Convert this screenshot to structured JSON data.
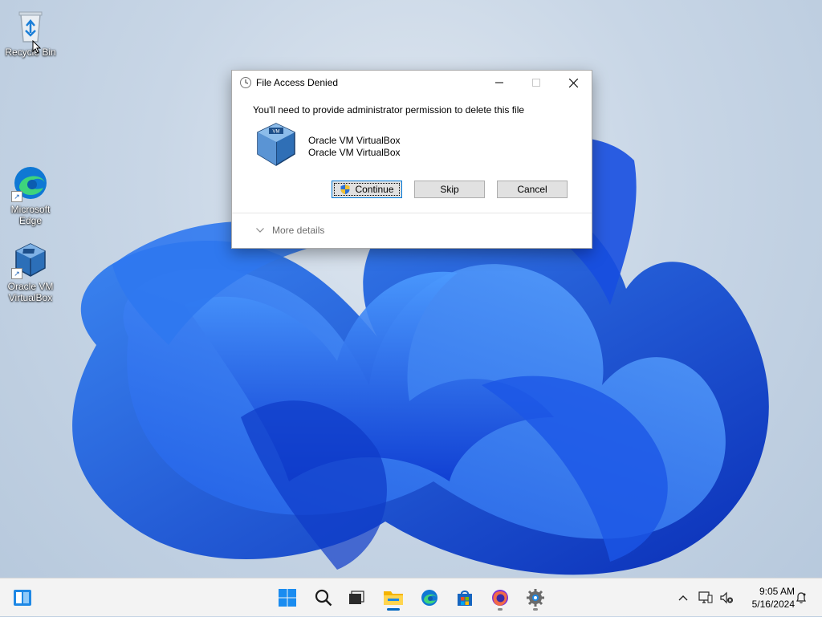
{
  "desktop": {
    "icons": [
      {
        "label": "Recycle Bin",
        "icon": "recycle-bin-icon"
      },
      {
        "label": "Microsoft Edge",
        "icon": "edge-icon"
      },
      {
        "label": "Oracle VM VirtualBox",
        "icon": "virtualbox-icon"
      }
    ]
  },
  "dialog": {
    "title": "File Access Denied",
    "message": "You'll need to provide administrator permission to delete this file",
    "file_name_line1": "Oracle VM VirtualBox",
    "file_name_line2": "Oracle VM VirtualBox",
    "buttons": {
      "continue": "Continue",
      "skip": "Skip",
      "cancel": "Cancel"
    },
    "more_details": "More details"
  },
  "taskbar": {
    "items": [
      {
        "name": "widgets",
        "icon": "widgets-icon"
      },
      {
        "name": "start",
        "icon": "windows-start-icon"
      },
      {
        "name": "search",
        "icon": "search-icon"
      },
      {
        "name": "task-view",
        "icon": "task-view-icon"
      },
      {
        "name": "file-explorer",
        "icon": "folder-icon",
        "active": true
      },
      {
        "name": "edge",
        "icon": "edge-icon"
      },
      {
        "name": "store",
        "icon": "store-icon"
      },
      {
        "name": "firefox",
        "icon": "firefox-icon"
      },
      {
        "name": "settings",
        "icon": "gear-icon"
      }
    ],
    "time": "9:05 AM",
    "date": "5/16/2024"
  },
  "colors": {
    "accent": "#0067c0",
    "wallpaper_blue": "#1a4fd6",
    "taskbar_bg": "#f3f3f3"
  }
}
